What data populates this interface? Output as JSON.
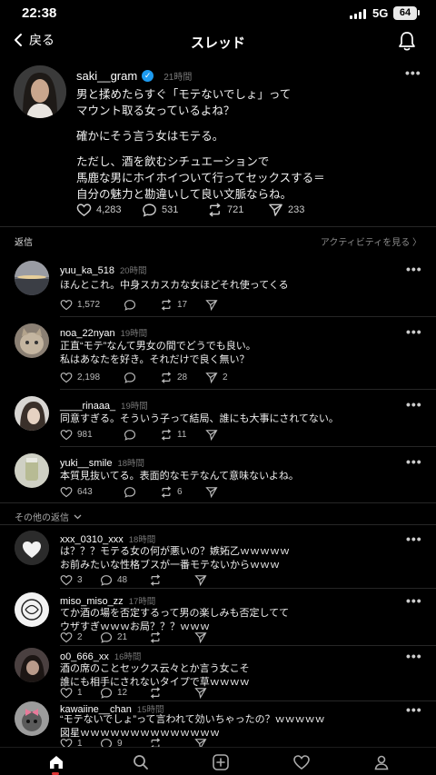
{
  "status": {
    "time": "22:38",
    "network": "5G",
    "battery": "64"
  },
  "header": {
    "back_label": "戻る",
    "title": "スレッド"
  },
  "main_post": {
    "username": "saki__gram",
    "time": "21時間",
    "paragraphs": [
      [
        "男と揉めたらすぐ「モテないでしょ」って",
        "マウント取る女っているよね？"
      ],
      [
        "確かにそう言う女はモテる。"
      ],
      [
        "ただし、酒を飲むシチュエーションで",
        "馬鹿な男にホイホイついて行ってセックスする＝",
        "自分の魅力と勘違いして良い文脈ならね。"
      ]
    ],
    "likes": "4,283",
    "comments": "531",
    "reposts": "721",
    "shares": "233"
  },
  "replies_section": {
    "title": "返信",
    "activity_link": "アクティビティを見る"
  },
  "replies": [
    {
      "username": "yuu_ka_518",
      "time": "20時間",
      "lines": [
        "ほんとこれ。中身スカスカな女ほどそれ使ってくる"
      ],
      "likes": "1,572",
      "comments": "",
      "reposts": "17"
    },
    {
      "username": "noa_22nyan",
      "time": "19時間",
      "lines": [
        "正直“モテ”なんて男女の間でどうでも良い。",
        "私はあなたを好き。それだけで良く無い？"
      ],
      "likes": "2,198",
      "comments": "",
      "reposts": "28",
      "shares": "2"
    },
    {
      "username": "____rinaaa_",
      "time": "19時間",
      "lines": [
        "同意すぎる。そういう子って結局、誰にも大事にされてない。"
      ],
      "likes": "981",
      "comments": "",
      "reposts": "11"
    },
    {
      "username": "yuki__smile",
      "time": "18時間",
      "lines": [
        "本質見抜いてる。表面的なモテなんて意味ないよね。"
      ],
      "likes": "643",
      "comments": "",
      "reposts": "6"
    }
  ],
  "other_replies_label": "その他の返信",
  "other_replies": [
    {
      "username": "xxx_0310_xxx",
      "time": "18時間",
      "lines": [
        "は？？？モテる女の何が悪いの？嫉妬乙ｗｗｗｗｗ",
        "お前みたいな性格ブスが一番モテないからｗｗｗ"
      ],
      "likes": "3",
      "comments": "48",
      "reposts": ""
    },
    {
      "username": "miso_miso_zz",
      "time": "17時間",
      "lines": [
        "てか酒の場を否定するって男の楽しみも否定してて",
        "ウザすぎｗｗｗお局？？？ｗｗｗ"
      ],
      "likes": "2",
      "comments": "21",
      "reposts": ""
    },
    {
      "username": "o0_666_xx",
      "time": "16時間",
      "lines": [
        "酒の席のことセックス云々とか言う女こそ",
        "誰にも相手にされないタイプで草ｗｗｗｗ"
      ],
      "likes": "1",
      "comments": "12",
      "reposts": ""
    },
    {
      "username": "kawaiine__chan",
      "time": "15時間",
      "lines": [
        "“モテないでしょ”って言われて効いちゃったの？ｗｗｗｗｗ",
        "図星ｗｗｗｗｗｗｗｗｗｗｗｗｗｗ"
      ],
      "likes": "1",
      "comments": "9",
      "reposts": ""
    }
  ],
  "colors": {
    "background": "#000000",
    "verified": "#1d9bf0",
    "text_secondary": "#777777"
  },
  "tabbar": {
    "icons": [
      "home-icon",
      "search-icon",
      "compose-icon",
      "heart-icon",
      "profile-icon"
    ]
  }
}
